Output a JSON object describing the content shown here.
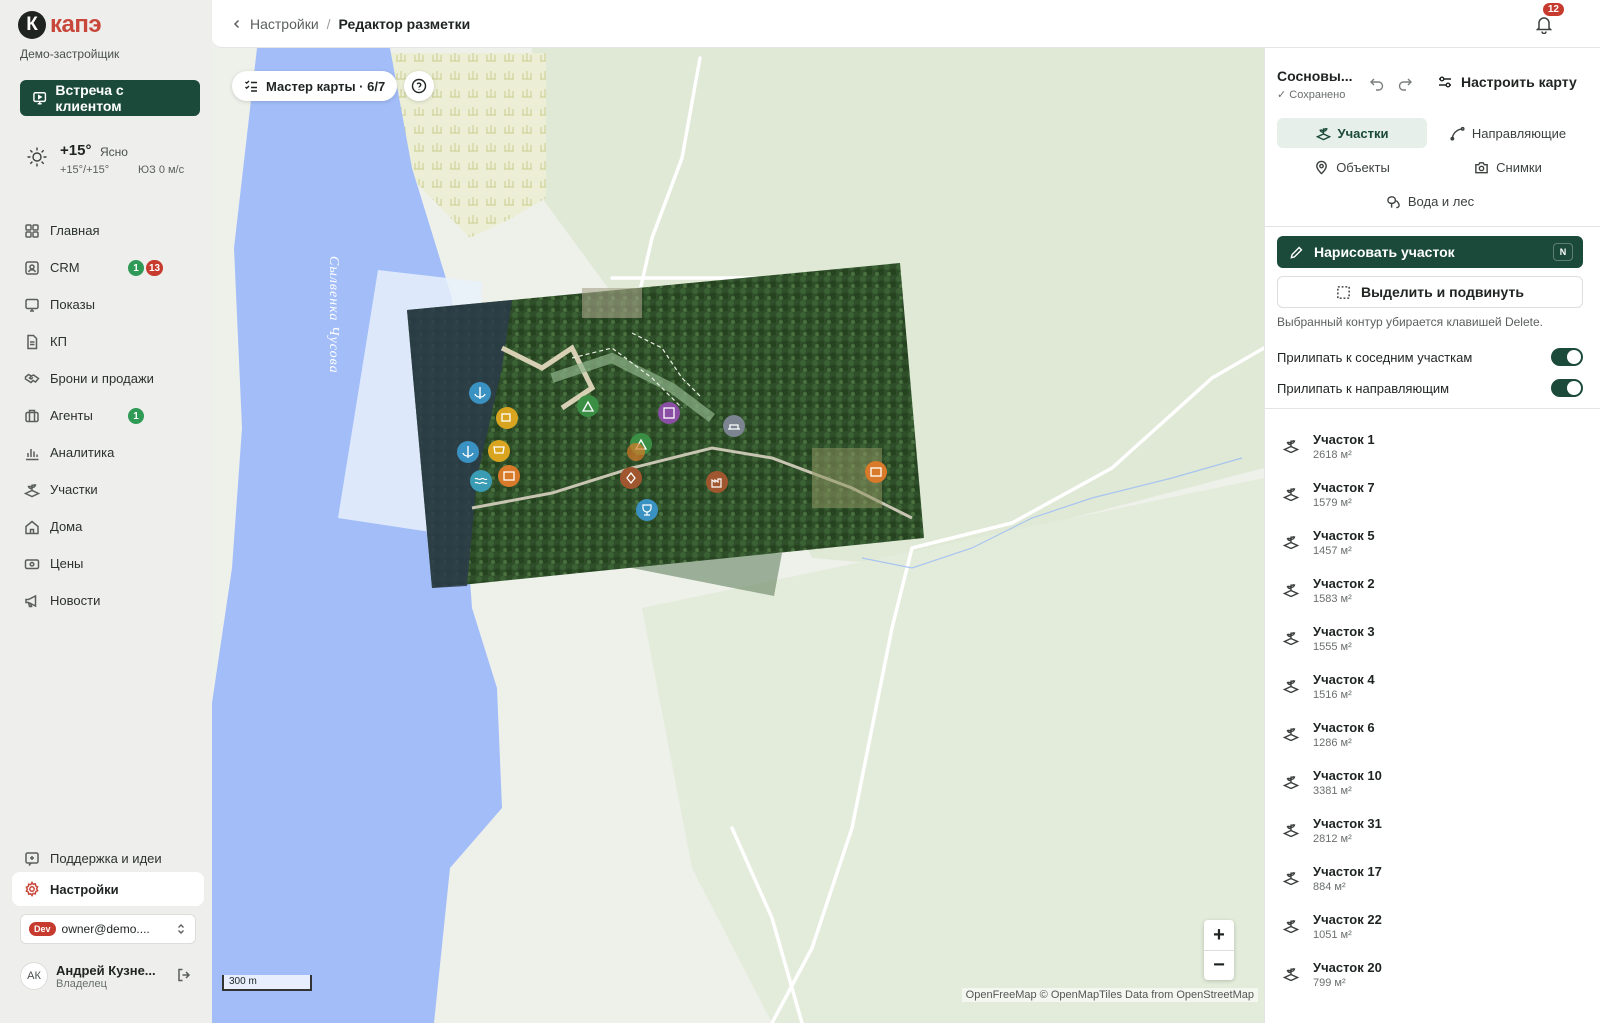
{
  "brand": {
    "logo_letter": "К",
    "logo_word": "капэ",
    "company": "Демо-застройщик"
  },
  "meeting_button": "Встреча с клиентом",
  "weather": {
    "temp": "+15°",
    "desc": "Ясно",
    "range": "+15°/+15°",
    "wind": "ЮЗ 0 м/с"
  },
  "nav": [
    {
      "label": "Главная"
    },
    {
      "label": "CRM",
      "badges": [
        "1",
        "13"
      ]
    },
    {
      "label": "Показы"
    },
    {
      "label": "КП"
    },
    {
      "label": "Брони и продажи"
    },
    {
      "label": "Агенты",
      "badges": [
        "1"
      ]
    },
    {
      "label": "Аналитика"
    },
    {
      "label": "Участки"
    },
    {
      "label": "Дома"
    },
    {
      "label": "Цены"
    },
    {
      "label": "Новости"
    }
  ],
  "support": "Поддержка и идеи",
  "settings": "Настройки",
  "account": {
    "env": "Dev",
    "email": "owner@demo...."
  },
  "user": {
    "initials": "АК",
    "name": "Андрей Кузне...",
    "role": "Владелец"
  },
  "breadcrumb": {
    "parent": "Настройки",
    "separator": "/",
    "current": "Редактор разметки"
  },
  "notifications": {
    "count": "12"
  },
  "map": {
    "wizard": "Мастер карты · 6/7",
    "river_label": "Сылвенка Чусова",
    "scale": "300 m",
    "attribution": "OpenFreeMap © OpenMapTiles Data from OpenStreetMap",
    "zoom_in": "+",
    "zoom_out": "−"
  },
  "panel": {
    "title": "Сосновы...",
    "saved": "✓ Сохранено",
    "configure": "Настроить карту",
    "tabs": [
      "Участки",
      "Направляющие",
      "Объекты",
      "Снимки",
      "Вода и лес"
    ],
    "draw": "Нарисовать участок",
    "draw_key": "N",
    "select": "Выделить и подвинуть",
    "hint": "Выбранный контур убирается клавишей Delete.",
    "snap_plots": "Прилипать к соседним участкам",
    "snap_guides": "Прилипать к направляющим",
    "plots": [
      {
        "name": "Участок 1",
        "area": "2618 м²"
      },
      {
        "name": "Участок 7",
        "area": "1579 м²"
      },
      {
        "name": "Участок 5",
        "area": "1457 м²"
      },
      {
        "name": "Участок 2",
        "area": "1583 м²"
      },
      {
        "name": "Участок 3",
        "area": "1555 м²"
      },
      {
        "name": "Участок 4",
        "area": "1516 м²"
      },
      {
        "name": "Участок 6",
        "area": "1286 м²"
      },
      {
        "name": "Участок 10",
        "area": "3381 м²"
      },
      {
        "name": "Участок 31",
        "area": "2812 м²"
      },
      {
        "name": "Участок 17",
        "area": "884 м²"
      },
      {
        "name": "Участок 22",
        "area": "1051 м²"
      },
      {
        "name": "Участок 20",
        "area": "799 м²"
      }
    ]
  },
  "colors": {
    "accent": "#1b4a3a",
    "brand": "#c8473a",
    "water": "#a3bdf9",
    "badge_red": "#c73a2e",
    "badge_green": "#2f9a55"
  }
}
